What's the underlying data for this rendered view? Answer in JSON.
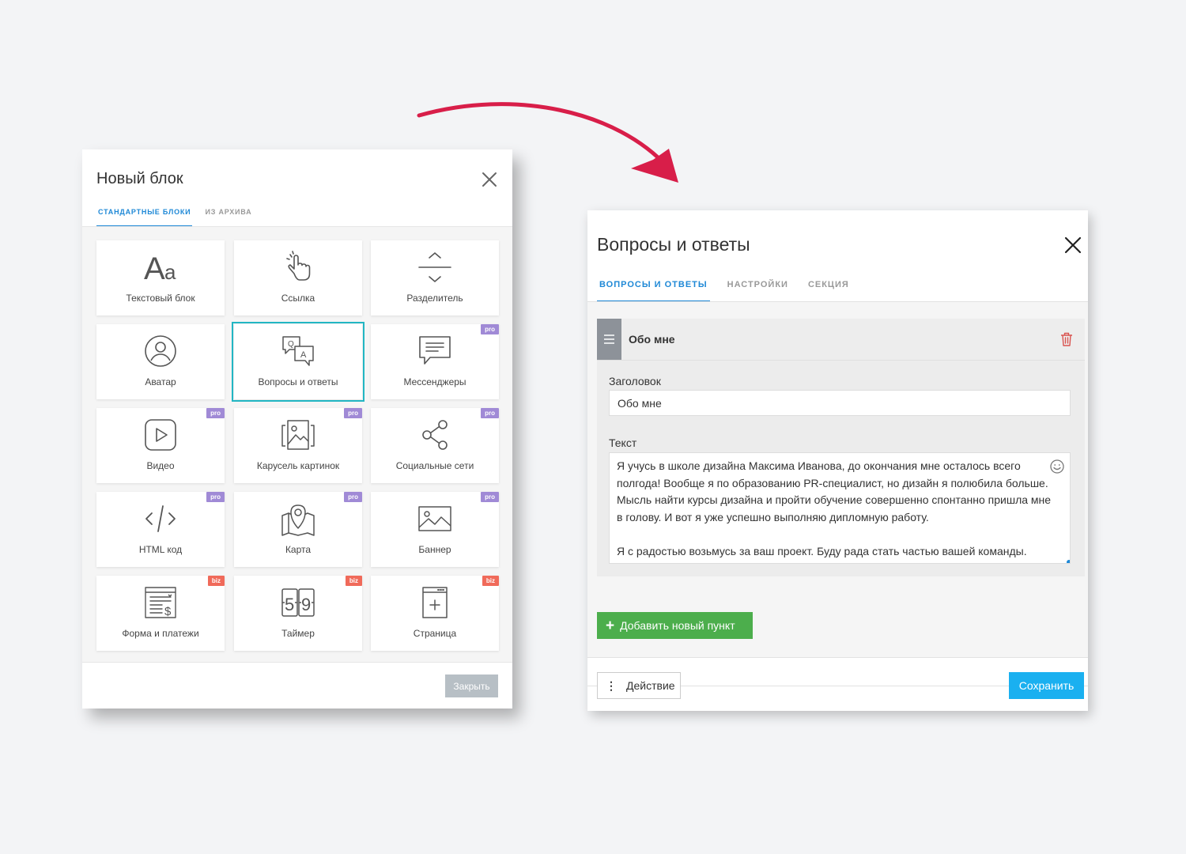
{
  "colors": {
    "arrow": "#d81e49",
    "accent_blue": "#1e88d6",
    "selected_tile": "#22b6c3",
    "pro_badge": "#a08ad6",
    "biz_badge": "#f06a5a",
    "add_button": "#4cae4c",
    "save_button": "#1ab0f0"
  },
  "new_block_dialog": {
    "title": "Новый блок",
    "close_icon": "close-icon",
    "tabs": [
      {
        "label": "СТАНДАРТНЫЕ БЛОКИ",
        "active": true
      },
      {
        "label": "ИЗ АРХИВА",
        "active": false
      }
    ],
    "tiles": [
      {
        "label": "Текстовый блок",
        "icon": "text-aa-icon",
        "badge": ""
      },
      {
        "label": "Ссылка",
        "icon": "pointer-hand-icon",
        "badge": ""
      },
      {
        "label": "Разделитель",
        "icon": "divider-icon",
        "badge": ""
      },
      {
        "label": "Аватар",
        "icon": "avatar-icon",
        "badge": ""
      },
      {
        "label": "Вопросы и ответы",
        "icon": "qa-bubbles-icon",
        "badge": "",
        "selected": true
      },
      {
        "label": "Мессенджеры",
        "icon": "message-icon",
        "badge": "pro"
      },
      {
        "label": "Видео",
        "icon": "play-icon",
        "badge": "pro"
      },
      {
        "label": "Карусель картинок",
        "icon": "carousel-icon",
        "badge": "pro"
      },
      {
        "label": "Социальные сети",
        "icon": "share-icon",
        "badge": "pro"
      },
      {
        "label": "HTML код",
        "icon": "code-icon",
        "badge": "pro"
      },
      {
        "label": "Карта",
        "icon": "map-icon",
        "badge": "pro"
      },
      {
        "label": "Баннер",
        "icon": "image-icon",
        "badge": "pro"
      },
      {
        "label": "Форма и платежи",
        "icon": "form-payment-icon",
        "badge": "biz"
      },
      {
        "label": "Таймер",
        "icon": "timer-icon",
        "badge": "biz"
      },
      {
        "label": "Страница",
        "icon": "page-icon",
        "badge": "biz"
      }
    ],
    "close_button": "Закрыть"
  },
  "qa_dialog": {
    "title": "Вопросы и ответы",
    "close_icon": "close-icon",
    "tabs": [
      {
        "label": "ВОПРОСЫ И ОТВЕТЫ",
        "active": true
      },
      {
        "label": "НАСТРОЙКИ",
        "active": false
      },
      {
        "label": "СЕКЦИЯ",
        "active": false
      }
    ],
    "item": {
      "name": "Обо мне",
      "title_label": "Заголовок",
      "title_value": "Обо мне",
      "text_label": "Текст",
      "text_value": "Я учусь в школе дизайна Максима Иванова, до окончания мне осталось всего полгода! Вообще я по образованию PR-специалист, но дизайн я полюбила больше. Мысль найти курсы дизайна и пройти обучение совершенно спонтанно пришла мне в голову. И вот я уже успешно выполняю дипломную работу.\n\nЯ с радостью возьмусь за ваш проект. Буду рада стать частью вашей команды."
    },
    "add_button": "Добавить новый пункт",
    "action_button": "Действие",
    "save_button": "Сохранить"
  }
}
